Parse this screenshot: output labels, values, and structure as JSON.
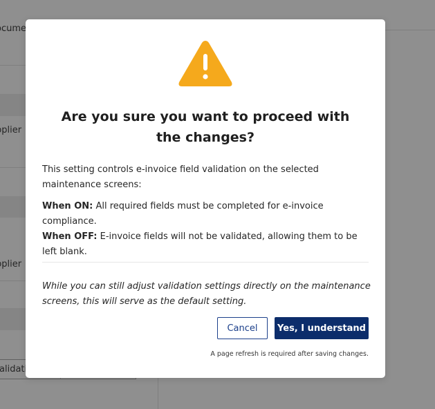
{
  "background": {
    "texts": [
      "ocume",
      "pplier",
      "pplier",
      "alidati"
    ]
  },
  "modal": {
    "icon": "warning-triangle-icon",
    "title": "Are you sure you want to proceed with the changes?",
    "intro": "This setting controls e-invoice field validation on the selected maintenance screens:",
    "on_label": "When ON:",
    "on_text": " All required fields must be completed for e-invoice compliance.",
    "off_label": "When OFF:",
    "off_text": " E-invoice fields will not be validated, allowing them to be left blank.",
    "note": "While you can still adjust validation settings directly on the maintenance screens, this will serve as the default setting.",
    "cancel_label": "Cancel",
    "confirm_label": "Yes, I understand",
    "refresh_note": "A page refresh is required after saving changes."
  },
  "colors": {
    "overlay": "#8f8f8f",
    "warning": "#f5a91c",
    "primary": "#0c2d6b",
    "cancel_border": "#1b3f8a"
  }
}
